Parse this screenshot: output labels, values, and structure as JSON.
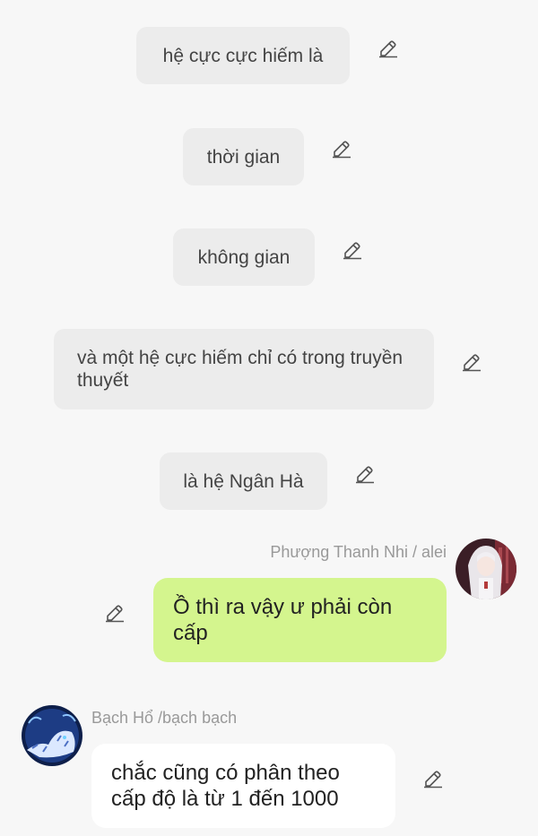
{
  "narration": [
    "hệ cực cực hiếm là",
    "thời gian",
    "không gian",
    "và một hệ cực hiếm chỉ có trong truyền thuyết",
    "là hệ Ngân Hà"
  ],
  "messages": [
    {
      "sender": "Phượng Thanh Nhi / alei",
      "side": "right",
      "text": "Ồ thì ra vậy ư phải còn cấp",
      "bubble_color": "#d4f58e"
    },
    {
      "sender": "Bạch Hổ /bạch bạch",
      "side": "left",
      "text": "chắc cũng có phân theo cấp độ là từ 1 đến 1000",
      "bubble_color": "#ffffff"
    }
  ],
  "icons": {
    "edit": "pencil-edit-icon",
    "avatar_right": "white-haired-girl-avatar",
    "avatar_left": "white-tiger-avatar"
  },
  "colors": {
    "background": "#f7f7f7",
    "narration_bg": "#ececec",
    "my_bubble": "#d4f58e",
    "other_bubble": "#ffffff",
    "sender_name": "#999999"
  }
}
